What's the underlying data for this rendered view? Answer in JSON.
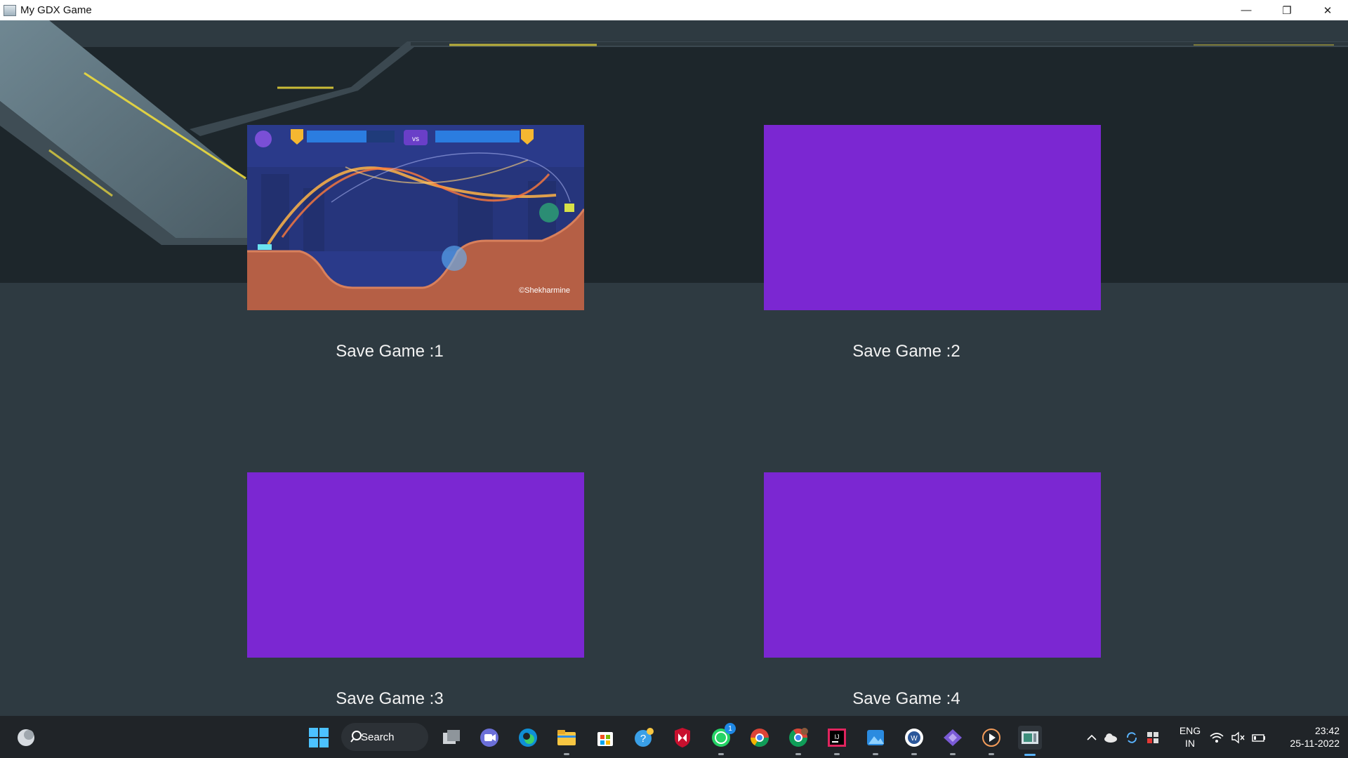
{
  "window": {
    "title": "My GDX Game",
    "minimize_glyph": "—",
    "restore_glyph": "❐",
    "close_glyph": "✕"
  },
  "slots": [
    {
      "label": "Save Game :1",
      "has_thumbnail": true,
      "thumbnail_credit": "©Shekharmine",
      "vs_label": "vs"
    },
    {
      "label": "Save Game :2",
      "has_thumbnail": false
    },
    {
      "label": "Save Game :3",
      "has_thumbnail": false
    },
    {
      "label": "Save Game :4",
      "has_thumbnail": false
    }
  ],
  "colors": {
    "empty_slot": "#7b27d2",
    "accent_glow": "#f6e23a",
    "background": "#2e3a41"
  },
  "taskbar": {
    "search_label": "Search",
    "language": "ENG",
    "region": "IN",
    "time": "23:42",
    "date": "25-11-2022",
    "whatsapp_badge": "1",
    "apps": [
      "start-icon",
      "search-icon",
      "task-view-icon",
      "teams-chat-icon",
      "edge-icon",
      "file-explorer-icon",
      "store-icon",
      "help-icon",
      "mcafee-icon",
      "whatsapp-icon",
      "chrome-icon",
      "chrome-profile-icon",
      "intellij-icon",
      "photos-icon",
      "word-icon",
      "visual-studio-icon",
      "media-player-icon",
      "gdx-game-icon"
    ]
  }
}
